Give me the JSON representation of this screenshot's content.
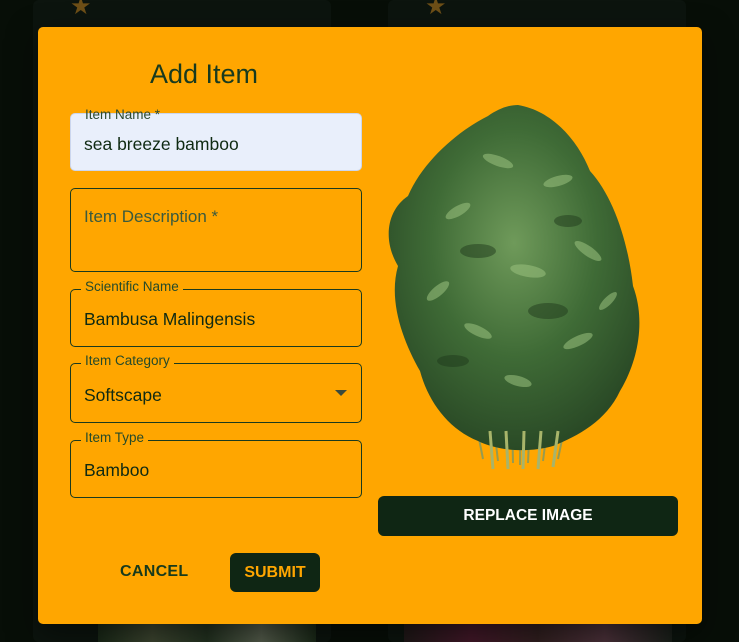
{
  "modal": {
    "title": "Add Item",
    "fields": {
      "item_name": {
        "label": "Item Name *",
        "value": "sea breeze bamboo"
      },
      "item_description": {
        "label": "Item Description *",
        "value": ""
      },
      "scientific_name": {
        "label": "Scientific Name",
        "value": "Bambusa Malingensis"
      },
      "item_category": {
        "label": "Item Category",
        "value": "Softscape"
      },
      "item_type": {
        "label": "Item Type",
        "value": "Bamboo"
      }
    },
    "buttons": {
      "cancel": "CANCEL",
      "submit": "SUBMIT",
      "replace_image": "REPLACE IMAGE"
    },
    "image": {
      "icon": "bamboo-plant-image"
    }
  },
  "colors": {
    "modal_bg": "#ffa600",
    "dark_green": "#0f2614",
    "background": "#0e1a0e",
    "star": "#c8902a"
  }
}
